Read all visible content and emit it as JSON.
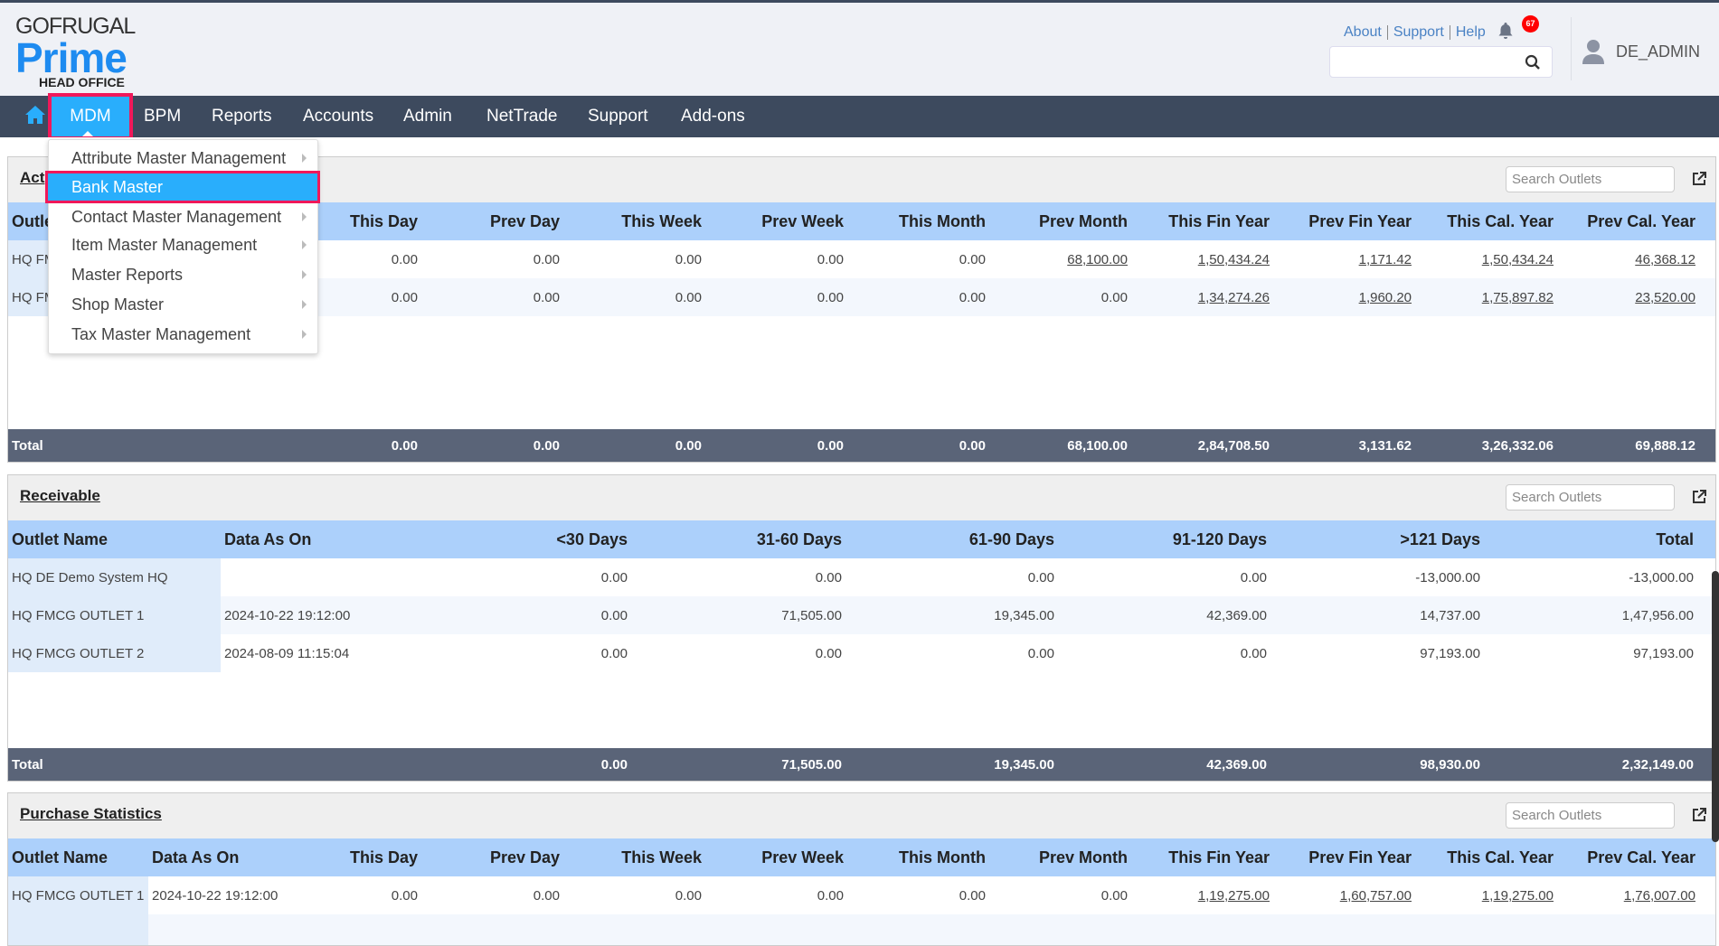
{
  "header": {
    "logo": {
      "brand": "GOFRUGAL",
      "product": "Prime",
      "edition": "HEAD OFFICE"
    },
    "links": [
      "About",
      "Support",
      "Help"
    ],
    "notifications": {
      "count": "67",
      "icon": "bell-icon"
    },
    "search": {
      "value": "",
      "placeholder": ""
    },
    "user": "DE_ADMIN"
  },
  "nav": {
    "active": "MDM",
    "items": [
      "BPM",
      "Reports",
      "Accounts",
      "Admin",
      "NetTrade",
      "Support",
      "Add-ons"
    ]
  },
  "mdm_menu": {
    "items": [
      {
        "label": "Attribute Master Management",
        "submenu": true
      },
      {
        "label": "Bank Master",
        "submenu": false,
        "selected": true
      },
      {
        "label": "Contact Master Management",
        "submenu": true
      },
      {
        "label": "Item Master Management",
        "submenu": true
      },
      {
        "label": "Master Reports",
        "submenu": true
      },
      {
        "label": "Shop Master",
        "submenu": true
      },
      {
        "label": "Tax Master Management",
        "submenu": true
      }
    ]
  },
  "panels": [
    {
      "title": "Act",
      "search_placeholder": "Search Outlets",
      "grid": "g1",
      "links_nonzero": true,
      "columns": [
        "Outle",
        "",
        "This Day",
        "Prev Day",
        "This Week",
        "Prev Week",
        "This Month",
        "Prev Month",
        "This Fin Year",
        "Prev Fin Year",
        "This Cal. Year",
        "Prev Cal. Year"
      ],
      "rows": [
        [
          "HQ FM",
          "",
          "0.00",
          "0.00",
          "0.00",
          "0.00",
          "0.00",
          "68,100.00",
          "1,50,434.24",
          "1,171.42",
          "1,50,434.24",
          "46,368.12"
        ],
        [
          "HQ FM",
          "",
          "0.00",
          "0.00",
          "0.00",
          "0.00",
          "0.00",
          "0.00",
          "1,34,274.26",
          "1,960.20",
          "1,75,897.82",
          "23,520.00"
        ]
      ],
      "total": [
        "Total",
        "",
        "0.00",
        "0.00",
        "0.00",
        "0.00",
        "0.00",
        "68,100.00",
        "2,84,708.50",
        "3,131.62",
        "3,26,332.06",
        "69,888.12"
      ]
    },
    {
      "title": "Receivable",
      "search_placeholder": "Search Outlets",
      "grid": "g2",
      "links_nonzero": false,
      "columns": [
        "Outlet Name",
        "Data As On",
        "<30 Days",
        "31-60 Days",
        "61-90 Days",
        "91-120 Days",
        ">121 Days",
        "Total"
      ],
      "rows": [
        [
          "HQ DE Demo System HQ",
          "",
          "0.00",
          "0.00",
          "0.00",
          "0.00",
          "-13,000.00",
          "-13,000.00"
        ],
        [
          "HQ FMCG OUTLET 1",
          "2024-10-22 19:12:00",
          "0.00",
          "71,505.00",
          "19,345.00",
          "42,369.00",
          "14,737.00",
          "1,47,956.00"
        ],
        [
          "HQ FMCG OUTLET 2",
          "2024-08-09 11:15:04",
          "0.00",
          "0.00",
          "0.00",
          "0.00",
          "97,193.00",
          "97,193.00"
        ]
      ],
      "total": [
        "Total",
        "",
        "0.00",
        "71,505.00",
        "19,345.00",
        "42,369.00",
        "98,930.00",
        "2,32,149.00"
      ]
    },
    {
      "title": "Purchase Statistics",
      "search_placeholder": "Search Outlets",
      "grid": "g1",
      "links_nonzero": true,
      "columns": [
        "Outlet Name",
        "Data As On",
        "This Day",
        "Prev Day",
        "This Week",
        "Prev Week",
        "This Month",
        "Prev Month",
        "This Fin Year",
        "Prev Fin Year",
        "This Cal. Year",
        "Prev Cal. Year"
      ],
      "rows": [
        [
          "HQ FMCG OUTLET 1",
          "2024-10-22 19:12:00",
          "0.00",
          "0.00",
          "0.00",
          "0.00",
          "0.00",
          "0.00",
          "1,19,275.00",
          "1,60,757.00",
          "1,19,275.00",
          "1,76,007.00"
        ],
        [
          "",
          "",
          "",
          "",
          "",
          "",
          "",
          "",
          "",
          "",
          "",
          ""
        ]
      ]
    }
  ]
}
